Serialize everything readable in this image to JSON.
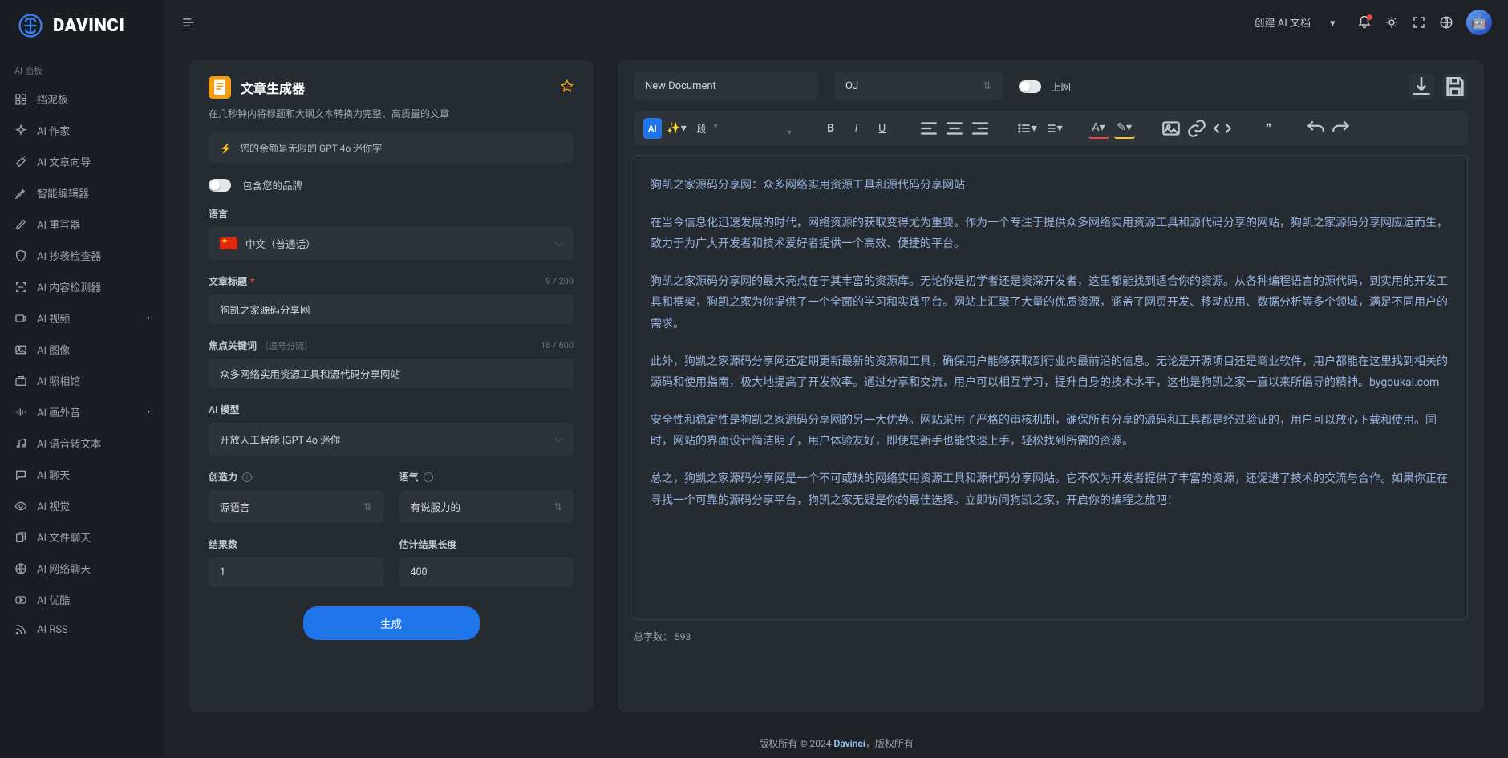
{
  "logo_text": "Davinci",
  "side_section": "AI 面板",
  "sidebar": {
    "items": [
      {
        "label": "挡泥板",
        "icon": "grid"
      },
      {
        "label": "AI 作家",
        "icon": "sparkle"
      },
      {
        "label": "AI 文章向导",
        "icon": "wand"
      },
      {
        "label": "智能编辑器",
        "icon": "pen"
      },
      {
        "label": "AI 重写器",
        "icon": "pencil"
      },
      {
        "label": "AI 抄袭检查器",
        "icon": "shield"
      },
      {
        "label": "AI 内容检测器",
        "icon": "scan"
      },
      {
        "label": "AI 视频",
        "icon": "video",
        "chev": true
      },
      {
        "label": "AI 图像",
        "icon": "image"
      },
      {
        "label": "AI 照相馆",
        "icon": "photo"
      },
      {
        "label": "AI 画外音",
        "icon": "wave",
        "chev": true
      },
      {
        "label": "AI 语音转文本",
        "icon": "music"
      },
      {
        "label": "AI 聊天",
        "icon": "chat"
      },
      {
        "label": "AI 视觉",
        "icon": "eye"
      },
      {
        "label": "AI 文件聊天",
        "icon": "files"
      },
      {
        "label": "AI 网络聊天",
        "icon": "globe"
      },
      {
        "label": "AI 优酷",
        "icon": "youtube"
      },
      {
        "label": "AI RSS",
        "icon": "rss"
      }
    ]
  },
  "topbar": {
    "create_doc": "创建 AI 文档"
  },
  "tool": {
    "title": "文章生成器",
    "desc": "在几秒钟内将标题和大纲文本转换为完整、高质量的文章",
    "balance": "您的余额是无限的 GPT 4o 迷你字",
    "brand": "包含您的品牌",
    "lang_label": "语言",
    "lang_value": "中文（普通话）",
    "title_label": "文章标题",
    "title_value": "狗凯之家源码分享网",
    "title_count": "9 / 200",
    "keywords_label": "焦点关键词",
    "keywords_hint": "（逗号分隔）",
    "keywords_value": "众多网络实用资源工具和源代码分享网站",
    "keywords_count": "18 / 600",
    "model_label": "AI 模型",
    "model_value": "开放人工智能 |GPT 4o 迷你",
    "creativity_label": "创造力",
    "creativity_value": "源语言",
    "tone_label": "语气",
    "tone_value": "有说服力的",
    "results_label": "结果数",
    "results_value": "1",
    "length_label": "估计结果长度",
    "length_value": "400",
    "generate": "生成"
  },
  "editor": {
    "doc_name": "New Document",
    "workspace": "OJ",
    "net": "上网",
    "para": "段",
    "wc_label": "总字数：",
    "wc_value": "593",
    "body": [
      "狗凯之家源码分享网：众多网络实用资源工具和源代码分享网站",
      "在当今信息化迅速发展的时代，网络资源的获取变得尤为重要。作为一个专注于提供众多网络实用资源工具和源代码分享的网站，狗凯之家源码分享网应运而生，致力于为广大开发者和技术爱好者提供一个高效、便捷的平台。",
      "狗凯之家源码分享网的最大亮点在于其丰富的资源库。无论你是初学者还是资深开发者，这里都能找到适合你的资源。从各种编程语言的源代码，到实用的开发工具和框架，狗凯之家为你提供了一个全面的学习和实践平台。网站上汇聚了大量的优质资源，涵盖了网页开发、移动应用、数据分析等多个领域，满足不同用户的需求。",
      "此外，狗凯之家源码分享网还定期更新最新的资源和工具，确保用户能够获取到行业内最前沿的信息。无论是开源项目还是商业软件，用户都能在这里找到相关的源码和使用指南，极大地提高了开发效率。通过分享和交流，用户可以相互学习，提升自身的技术水平，这也是狗凯之家一直以来所倡导的精神。bygoukai.com",
      "安全性和稳定性是狗凯之家源码分享网的另一大优势。网站采用了严格的审核机制，确保所有分享的源码和工具都是经过验证的，用户可以放心下载和使用。同时，网站的界面设计简洁明了，用户体验友好，即使是新手也能快速上手，轻松找到所需的资源。",
      "总之，狗凯之家源码分享网是一个不可或缺的网络实用资源工具和源代码分享网站。它不仅为开发者提供了丰富的资源，还促进了技术的交流与合作。如果你正在寻找一个可靠的源码分享平台，狗凯之家无疑是你的最佳选择。立即访问狗凯之家，开启你的编程之旅吧！"
    ]
  },
  "footer": {
    "pre": "版权所有 © 2024 ",
    "brand": "Davinci",
    "post": "，版权所有"
  }
}
